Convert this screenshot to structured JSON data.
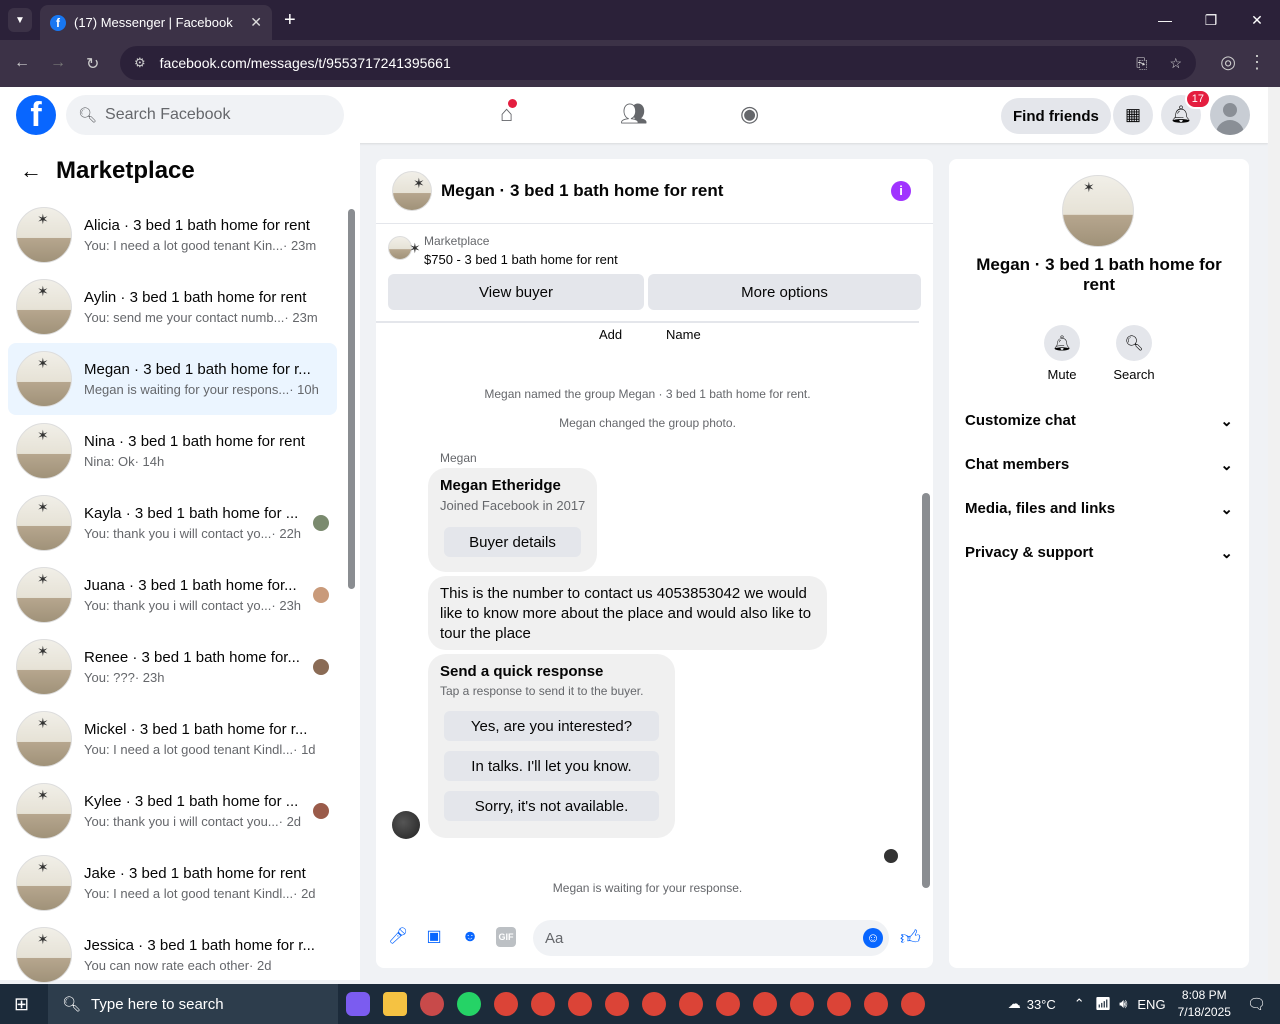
{
  "browser": {
    "tab_title": "(17) Messenger | Facebook",
    "url": "facebook.com/messages/t/9553717241395661"
  },
  "fb": {
    "search_placeholder": "Search Facebook",
    "find_friends": "Find friends",
    "notif_count": "17"
  },
  "left": {
    "title": "Marketplace",
    "conversations": [
      {
        "title": "Alicia · 3 bed 1 bath home for rent",
        "preview": "You: I need a lot good tenant Kin...",
        "time": "· 23m"
      },
      {
        "title": "Aylin · 3 bed 1 bath home for rent",
        "preview": "You: send me your contact numb...",
        "time": "· 23m"
      },
      {
        "title": "Megan · 3 bed 1 bath home for r...",
        "preview": "Megan is waiting for your respons...",
        "time": "· 10h"
      },
      {
        "title": "Nina · 3 bed 1 bath home for rent",
        "preview": "Nina: Ok",
        "time": "· 14h"
      },
      {
        "title": "Kayla · 3 bed 1 bath home for ...",
        "preview": "You: thank you i will contact yo...",
        "time": "· 22h"
      },
      {
        "title": "Juana · 3 bed 1 bath home for...",
        "preview": "You: thank you i will contact yo...",
        "time": "· 23h"
      },
      {
        "title": "Renee · 3 bed 1 bath home for...",
        "preview": "You: ???",
        "time": "· 23h"
      },
      {
        "title": "Mickel · 3 bed 1 bath home for r...",
        "preview": "You: I need a lot good tenant Kindl...",
        "time": "· 1d"
      },
      {
        "title": "Kylee · 3 bed 1 bath home for ...",
        "preview": "You: thank you i will contact you...",
        "time": "· 2d"
      },
      {
        "title": "Jake · 3 bed 1 bath home for rent",
        "preview": "You: I need a lot good tenant Kindl...",
        "time": "· 2d"
      },
      {
        "title": "Jessica · 3 bed 1 bath home for r...",
        "preview": "You can now rate each other",
        "time": "· 2d"
      }
    ]
  },
  "chat": {
    "title": "Megan · 3 bed 1 bath home for rent",
    "marketplace_label": "Marketplace",
    "listing": "$750 - 3 bed 1 bath home for rent",
    "view_buyer": "View buyer",
    "more_options": "More options",
    "add_label": "Add",
    "name_label": "Name",
    "sys1": "Megan named the group Megan · 3 bed 1 bath home for rent.",
    "sys2": "Megan changed the group photo.",
    "sender": "Megan",
    "profile_name": "Megan Etheridge",
    "profile_joined": "Joined Facebook in 2017",
    "buyer_details": "Buyer details",
    "message": "This is the number to contact us 4053853042 we would like to know more about the place and would also like to tour the place",
    "quick_title": "Send a quick response",
    "quick_sub": "Tap a response to send it to the buyer.",
    "quick1": "Yes, are you interested?",
    "quick2": "In talks. I'll let you know.",
    "quick3": "Sorry, it's not available.",
    "waiting": "Megan is waiting for your response.",
    "composer_placeholder": "Aa"
  },
  "right": {
    "title": "Megan · 3 bed 1 bath home for rent",
    "mute": "Mute",
    "search": "Search",
    "sections": [
      "Customize chat",
      "Chat members",
      "Media, files and links",
      "Privacy & support"
    ]
  },
  "taskbar": {
    "search_placeholder": "Type here to search",
    "temp": "33°C",
    "lang": "ENG",
    "time": "8:08 PM",
    "date": "7/18/2025"
  }
}
